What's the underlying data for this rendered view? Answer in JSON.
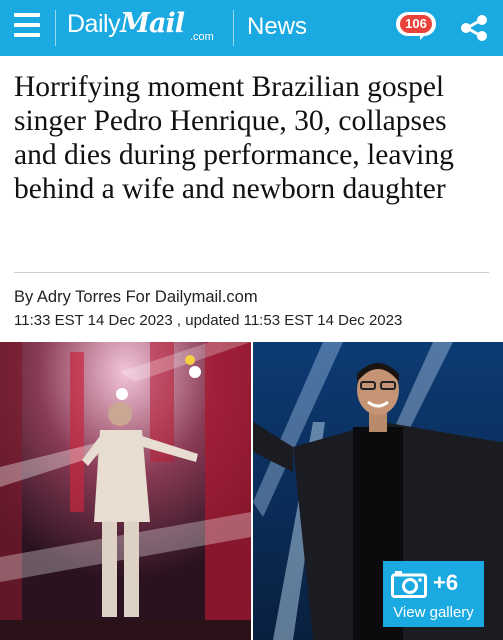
{
  "header": {
    "logo_daily": "Daily",
    "logo_mail": "Mail",
    "logo_com": ".com",
    "section": "News",
    "comment_count": "106",
    "colors": {
      "bar": "#1aa9e1",
      "badge": "#e8423b"
    }
  },
  "article": {
    "headline": "Horrifying moment Brazilian gospel singer Pedro Henrique, 30, collapses and dies during performance, leaving behind a wife and newborn daughter",
    "byline": "By Adry Torres For Dailymail.com",
    "dateline": "11:33 EST 14 Dec 2023 , updated 11:53 EST 14 Dec 2023"
  },
  "gallery": {
    "extra_count": "+6",
    "label": "View gallery"
  }
}
